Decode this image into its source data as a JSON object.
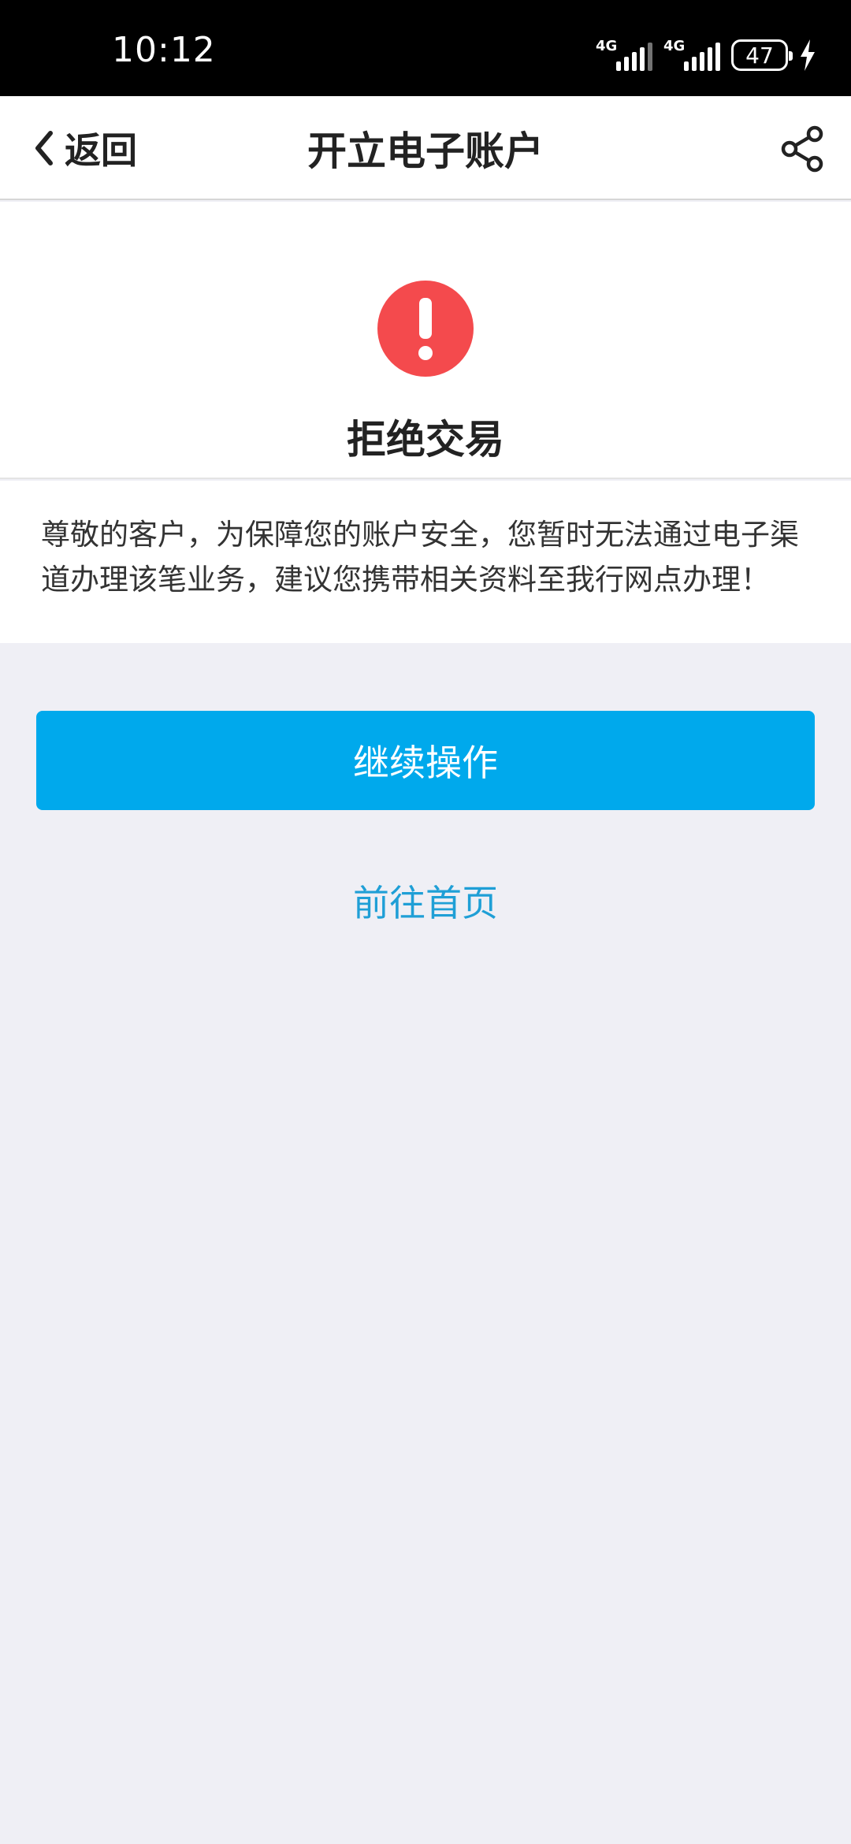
{
  "status_bar": {
    "time": "10:12",
    "network_1": "4G",
    "network_2": "4G",
    "battery": "47"
  },
  "nav": {
    "back_label": "返回",
    "title": "开立电子账户"
  },
  "result": {
    "title": "拒绝交易",
    "message": "尊敬的客户，为保障您的账户安全，您暂时无法通过电子渠道办理该笔业务，建议您携带相关资料至我行网点办理！"
  },
  "actions": {
    "continue_label": "继续操作",
    "home_label": "前往首页"
  },
  "colors": {
    "primary": "#00a9ec",
    "link": "#1f9fd6",
    "alert": "#f44a4d",
    "background": "#efeff5"
  },
  "icons": {
    "back": "chevron-left-icon",
    "share": "share-icon",
    "alert": "exclamation-circle-icon",
    "charging": "lightning-bolt-icon"
  }
}
